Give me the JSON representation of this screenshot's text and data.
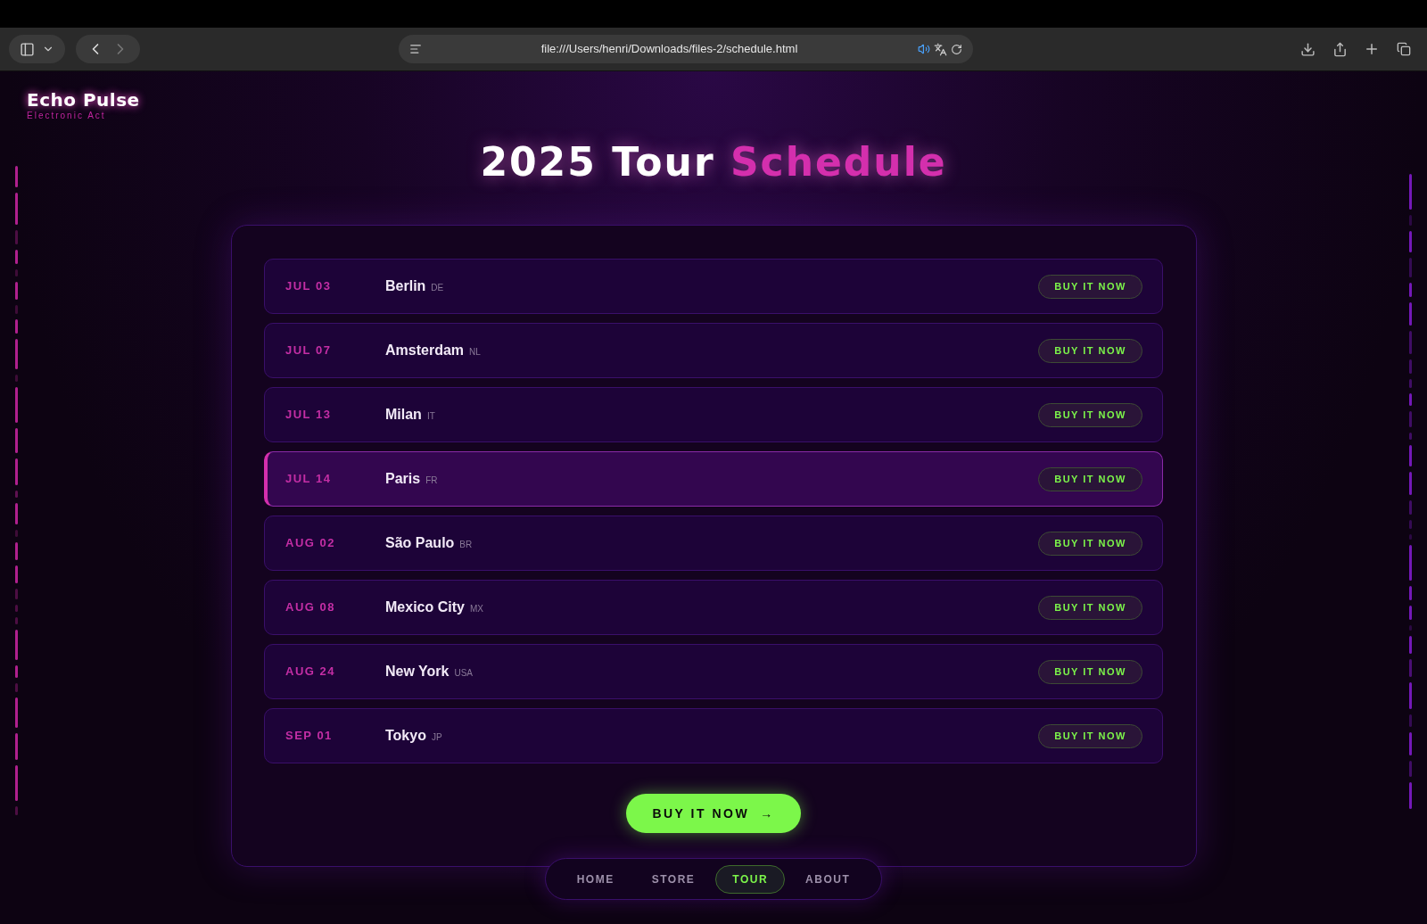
{
  "browser": {
    "url": "file:///Users/henri/Downloads/files-2/schedule.html"
  },
  "brand": {
    "name": "Echo Pulse",
    "tagline": "Electronic Act"
  },
  "heading": {
    "text": "2025 Tour ",
    "accent": "Schedule"
  },
  "shows": [
    {
      "date": "JUL 03",
      "city": "Berlin",
      "country": "DE",
      "button": "BUY IT NOW",
      "selected": false
    },
    {
      "date": "JUL 07",
      "city": "Amsterdam",
      "country": "NL",
      "button": "BUY IT NOW",
      "selected": false
    },
    {
      "date": "JUL 13",
      "city": "Milan",
      "country": "IT",
      "button": "BUY IT NOW",
      "selected": false
    },
    {
      "date": "JUL 14",
      "city": "Paris",
      "country": "FR",
      "button": "BUY IT NOW",
      "selected": true
    },
    {
      "date": "AUG 02",
      "city": "São Paulo",
      "country": "BR",
      "button": "BUY IT NOW",
      "selected": false
    },
    {
      "date": "AUG 08",
      "city": "Mexico City",
      "country": "MX",
      "button": "BUY IT NOW",
      "selected": false
    },
    {
      "date": "AUG 24",
      "city": "New York",
      "country": "USA",
      "button": "BUY IT NOW",
      "selected": false
    },
    {
      "date": "SEP 01",
      "city": "Tokyo",
      "country": "JP",
      "button": "BUY IT NOW",
      "selected": false
    }
  ],
  "cta": {
    "label": "BUY IT NOW",
    "arrow": "→"
  },
  "nav": [
    {
      "label": "HOME",
      "selected": false
    },
    {
      "label": "STORE",
      "selected": false
    },
    {
      "label": "TOUR",
      "selected": true
    },
    {
      "label": "ABOUT",
      "selected": false
    }
  ]
}
